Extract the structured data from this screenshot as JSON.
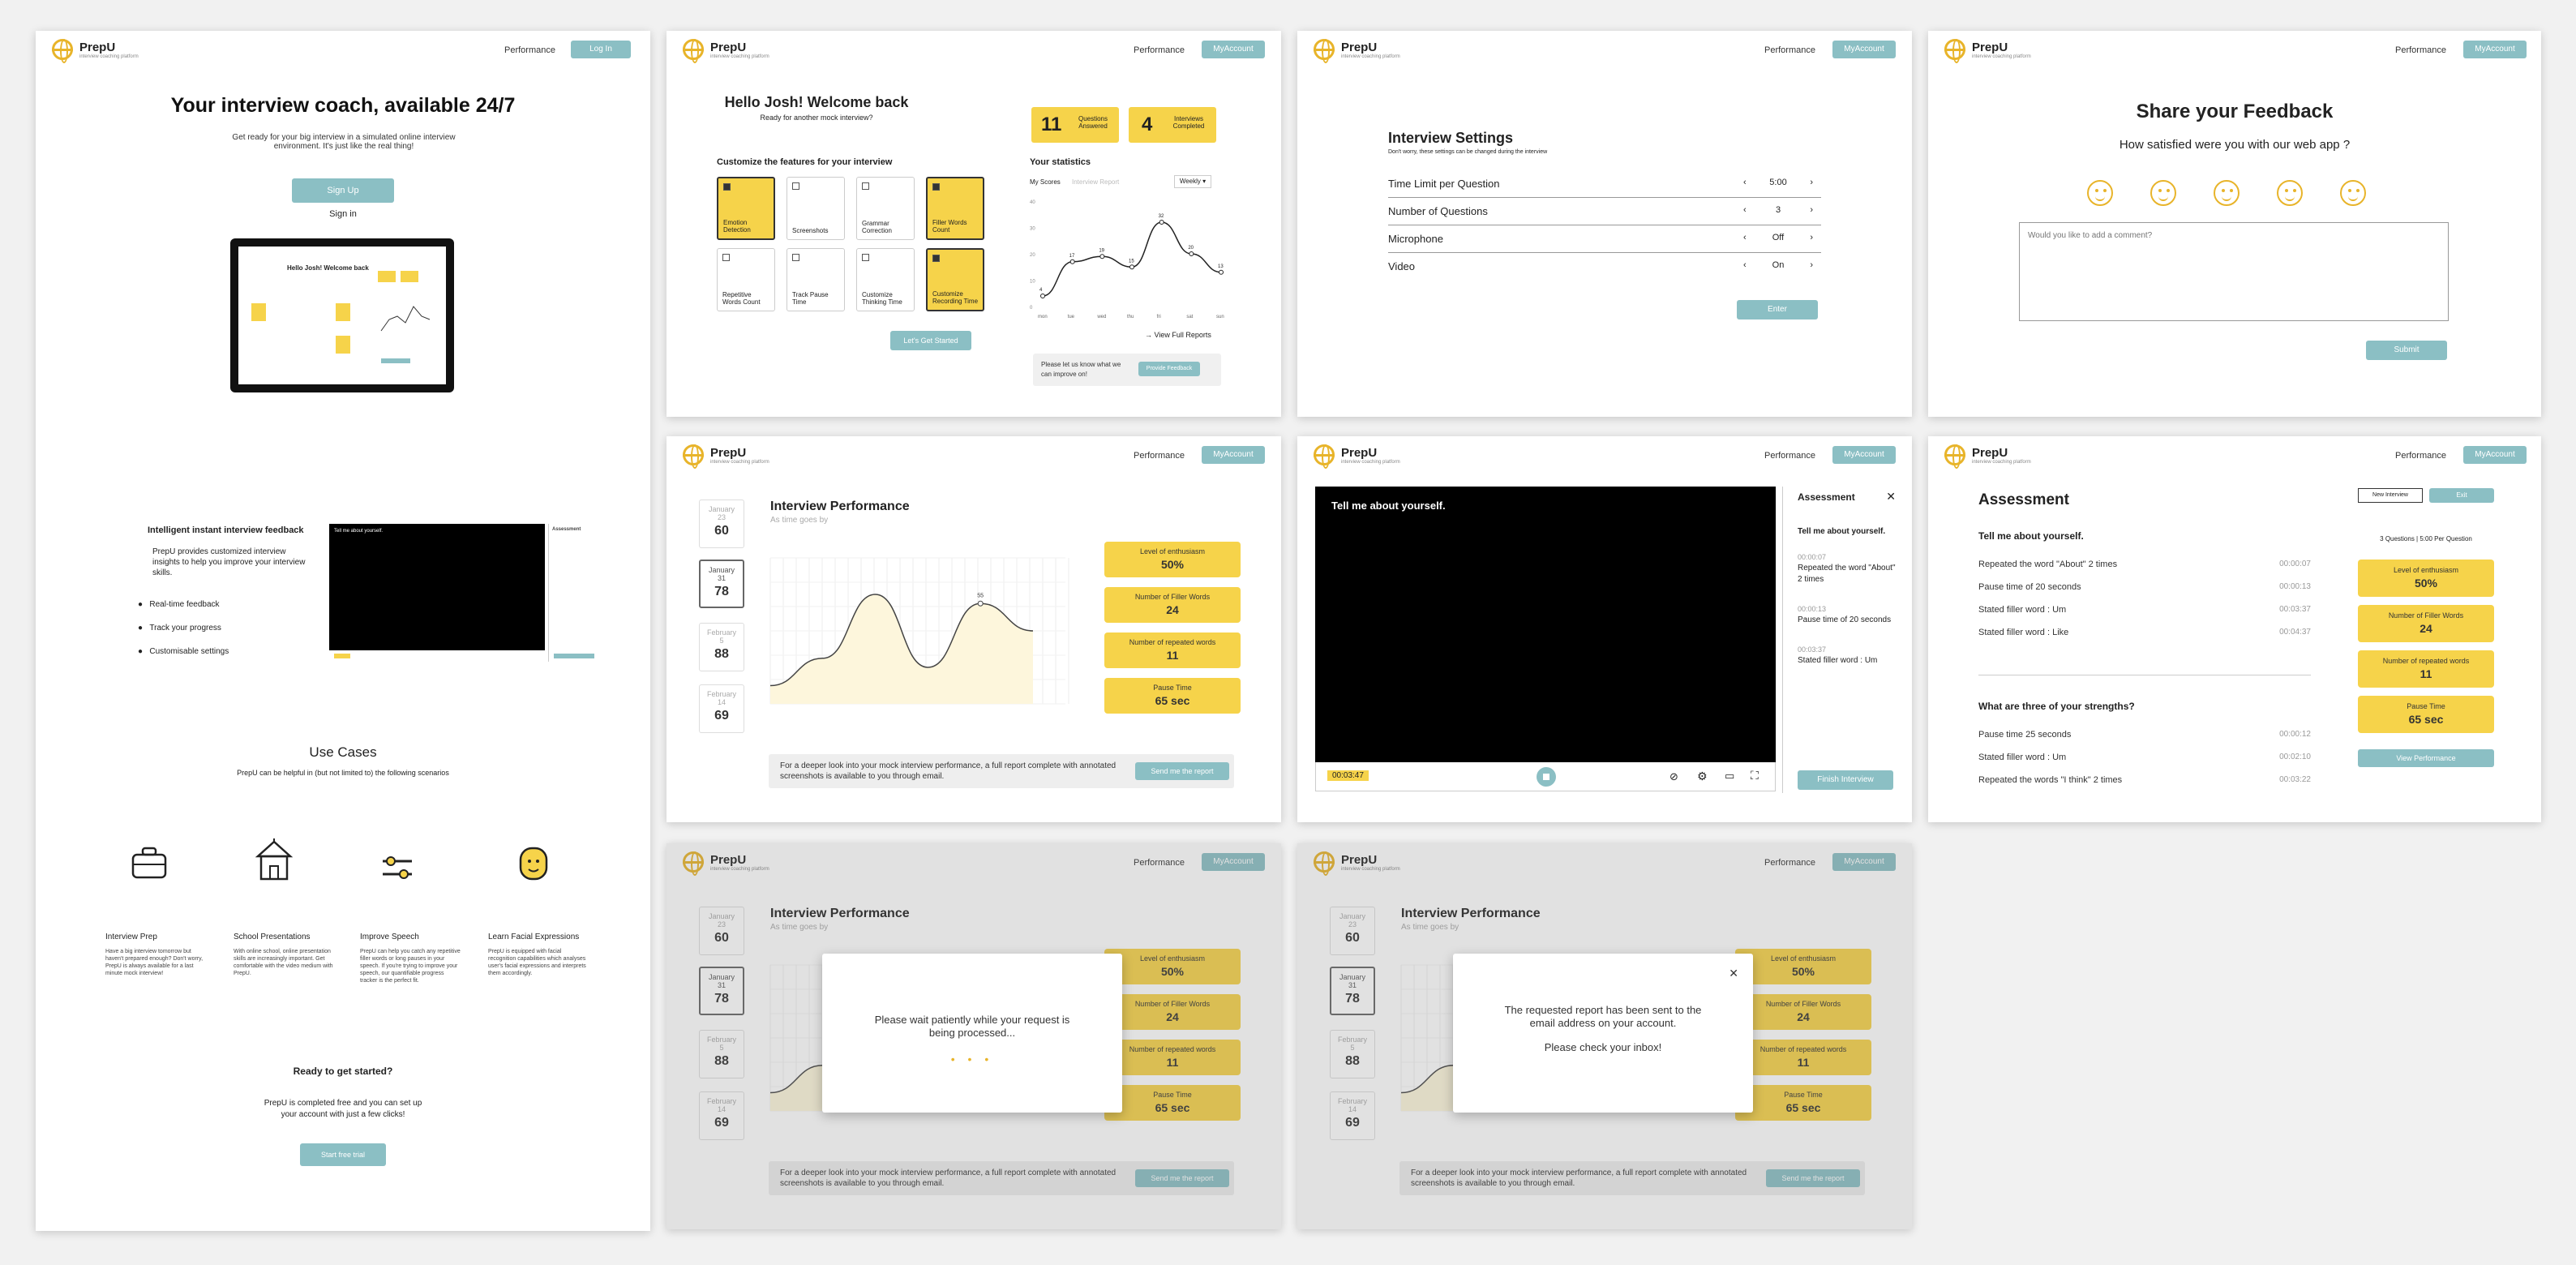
{
  "brand": {
    "name": "PrepU",
    "tagline": "interview coaching platform"
  },
  "nav": {
    "performance": "Performance",
    "login": "Log In",
    "my_account": "MyAccount"
  },
  "landing": {
    "hero_title": "Your interview coach, available 24/7",
    "hero_sub": "Get ready for your big interview in a simulated online interview environment. It's just like the real thing!",
    "signup": "Sign Up",
    "signin": "Sign in",
    "feature_title": "Intelligent instant interview feedback",
    "feature_desc": "PrepU provides customized interview insights to help you improve your interview skills.",
    "bullets": [
      "Real-time feedback",
      "Track your progress",
      "Customisable settings"
    ],
    "use_cases_title": "Use Cases",
    "use_cases_sub": "PrepU can be helpful in (but not limited to) the following scenarios",
    "use_cases": [
      {
        "title": "Interview Prep",
        "icon": "briefcase-icon",
        "desc": "Have a big interview tomorrow but haven't prepared enough? Don't worry, PrepU is always available for a last minute mock interview!"
      },
      {
        "title": "School Presentations",
        "icon": "school-icon",
        "desc": "With online school, online presentation skills are increasingly important. Get comfortable with the video medium with PrepU."
      },
      {
        "title": "Improve Speech",
        "icon": "sliders-icon",
        "desc": "PrepU can help you catch any repetitive filler words or long pauses in your speech. If you're trying to improve your speech, our quantifiable progress tracker is the perfect fit."
      },
      {
        "title": "Learn Facial Expressions",
        "icon": "face-icon",
        "desc": "PrepU is equipped with facial recognition capabilities which analyses user's facial expressions and interprets them accordingly."
      }
    ],
    "cta_title": "Ready to get started?",
    "cta_desc": "PrepU is completed free and you can set up your account with just a few clicks!",
    "cta_button": "Start free trial",
    "mini_video_text": "Tell me about yourself."
  },
  "dashboard": {
    "welcome": "Hello Josh! Welcome back",
    "welcome_sub": "Ready for another mock interview?",
    "customize_title": "Customize the features for your interview",
    "features": [
      {
        "label": "Emotion Detection",
        "on": true
      },
      {
        "label": "Screenshots",
        "on": false
      },
      {
        "label": "Grammar Correction",
        "on": false
      },
      {
        "label": "Filler Words Count",
        "on": true
      },
      {
        "label": "Repetitive Words Count",
        "on": false
      },
      {
        "label": "Track Pause Time",
        "on": false
      },
      {
        "label": "Customize Thinking Time",
        "on": false
      },
      {
        "label": "Customize Recording Time",
        "on": true
      }
    ],
    "start_button": "Let's Get Started",
    "questions_answered": "11",
    "questions_label": "Questions Answered",
    "interviews_completed": "4",
    "interviews_label": "Interviews Completed",
    "stats_title": "Your statistics",
    "tab_scores": "My Scores",
    "tab_reports": "Interview Report",
    "period": "Weekly",
    "week_days": [
      "mon",
      "tue",
      "wed",
      "thu",
      "fri",
      "sat",
      "sun"
    ],
    "week_values": [
      4,
      17,
      19,
      15,
      32,
      20,
      13
    ],
    "view_full": "View Full Reports",
    "improve_text": "Please let us know what we can improve on!",
    "feedback_button": "Provide Feedback"
  },
  "settings": {
    "title": "Interview Settings",
    "sub": "Don't worry, these settings can be changed during the interview",
    "rows": [
      {
        "label": "Time Limit per Question",
        "value": "5:00"
      },
      {
        "label": "Number of Questions",
        "value": "3"
      },
      {
        "label": "Microphone",
        "value": "Off"
      },
      {
        "label": "Video",
        "value": "On"
      }
    ],
    "enter": "Enter"
  },
  "feedback": {
    "title": "Share your Feedback",
    "question": "How satisfied were you with our web app ?",
    "placeholder": "Would you like to add a comment?",
    "submit": "Submit"
  },
  "performance": {
    "title": "Interview Performance",
    "sub": "As time goes by",
    "dates": [
      {
        "month": "January",
        "day": "23",
        "score": "60"
      },
      {
        "month": "January",
        "day": "31",
        "score": "78"
      },
      {
        "month": "February",
        "day": "5",
        "score": "88"
      },
      {
        "month": "February",
        "day": "14",
        "score": "69"
      }
    ],
    "stats": [
      {
        "label": "Level of enthusiasm",
        "value": "50%"
      },
      {
        "label": "Number of Filler Words",
        "value": "24"
      },
      {
        "label": "Number of repeated words",
        "value": "11"
      },
      {
        "label": "Pause Time",
        "value": "65 sec"
      }
    ],
    "point_label": "55",
    "note": "For a deeper look into your mock interview performance, a full report complete with annotated  screenshots is available to you through email.",
    "send_button": "Send me the report",
    "chart_data": {
      "type": "line",
      "values": [
        10,
        25,
        60,
        20,
        55,
        40
      ]
    }
  },
  "interview": {
    "question": "Tell me about yourself.",
    "timer": "00:03:47",
    "panel_title": "Assessment",
    "panel_question": "Tell me about yourself.",
    "entries": [
      {
        "time": "00:00:07",
        "text": "Repeated the word \"About\" 2 times"
      },
      {
        "time": "00:00:13",
        "text": "Pause time of 20 seconds"
      },
      {
        "time": "00:03:37",
        "text": "Stated filler word : Um"
      }
    ],
    "finish": "Finish Interview"
  },
  "assessment": {
    "title": "Assessment",
    "new_interview": "New Interview",
    "exit": "Exit",
    "meta": "3 Questions | 5:00 Per Question",
    "q1": "Tell me about yourself.",
    "q1_rows": [
      {
        "text": "Repeated the word \"About\" 2 times",
        "time": "00:00:07"
      },
      {
        "text": "Pause time of 20 seconds",
        "time": "00:00:13"
      },
      {
        "text": "Stated filler word : Um",
        "time": "00:03:37"
      },
      {
        "text": "Stated filler word : Like",
        "time": "00:04:37"
      }
    ],
    "q2": "What are three of your strengths?",
    "q2_rows": [
      {
        "text": "Pause time 25 seconds",
        "time": "00:00:12"
      },
      {
        "text": "Stated filler word : Um",
        "time": "00:02:10"
      },
      {
        "text": "Repeated the words \"I think\" 2 times",
        "time": "00:03:22"
      }
    ],
    "view_perf": "View Performance"
  },
  "modals": {
    "processing": "Please wait patiently while your request is being processed...",
    "sent": "The requested report has been sent to the email address on your account.",
    "check": "Please check your inbox!"
  },
  "colors": {
    "accent": "#8bbfc4",
    "yellow": "#f6d34a",
    "brand": "#e8b42a"
  }
}
